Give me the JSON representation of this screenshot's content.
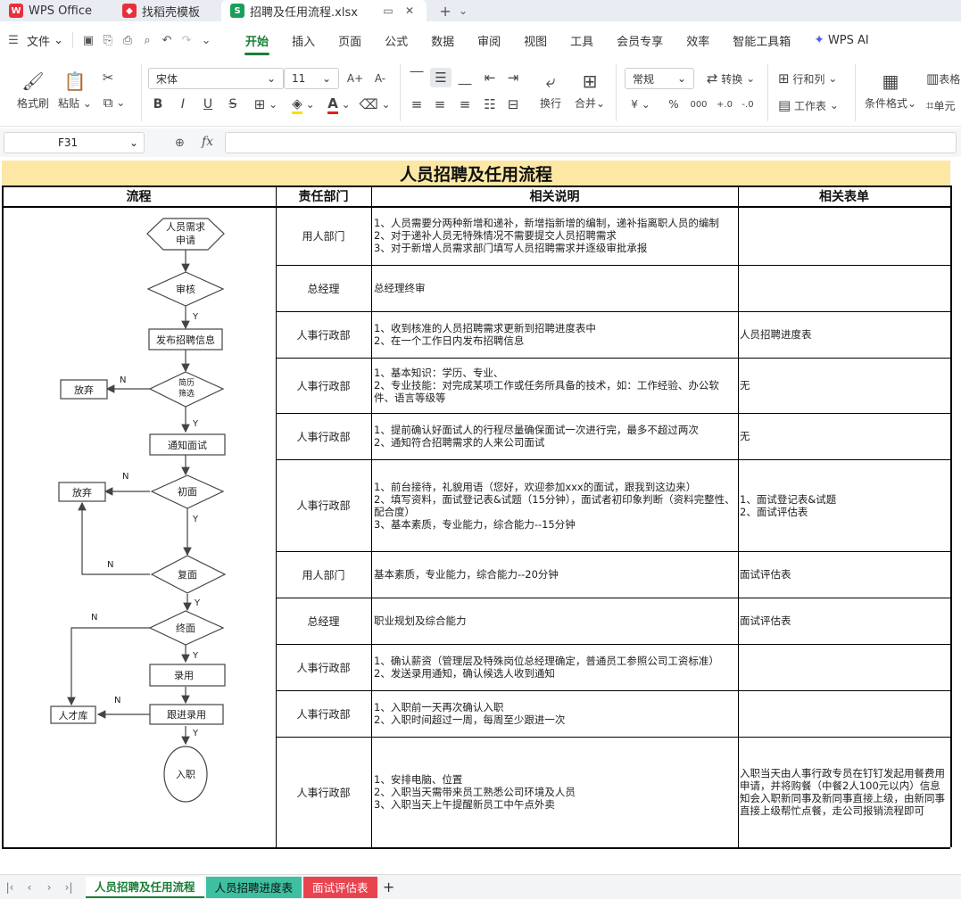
{
  "titlebar": {
    "tabs": [
      {
        "label": "WPS Office",
        "icon": "wps-logo-icon"
      },
      {
        "label": "找稻壳模板",
        "icon": "docer-icon"
      },
      {
        "label": "招聘及任用流程.xlsx",
        "icon": "spreadsheet-s-icon"
      }
    ],
    "logo_letter_w": "W",
    "logo_letter_s": "S"
  },
  "menubar": {
    "file_label": "文件",
    "items": [
      "开始",
      "插入",
      "页面",
      "公式",
      "数据",
      "审阅",
      "视图",
      "工具",
      "会员专享",
      "效率",
      "智能工具箱"
    ],
    "active": "开始",
    "wps_ai": "WPS AI"
  },
  "ribbon": {
    "format_painter": "格式刷",
    "paste": "粘贴",
    "font_name": "宋体",
    "font_size": "11",
    "wrap": "换行",
    "merge": "合并",
    "number_format": "常规",
    "convert": "转换",
    "row_col": "行和列",
    "worksheet": "工作表",
    "cond_format": "条件格式",
    "table_style": "表格",
    "cell": "单元",
    "bold": "B",
    "italic": "I",
    "underline": "U",
    "strike": "S",
    "currency": "¥",
    "percent": "%",
    "thousands": "000",
    "inc_dec": "+.0",
    "dec_dec": "-.0",
    "font_color_letter": "A",
    "grow_font": "A+",
    "shrink_font": "A-",
    "accent": "#1a7f37"
  },
  "formula_bar": {
    "cell_ref": "F31",
    "fx": "fx",
    "content": ""
  },
  "sheet": {
    "title": "人员招聘及任用流程",
    "headers": [
      "流程",
      "责任部门",
      "相关说明",
      "相关表单"
    ],
    "title_bg": "#fce8a4",
    "rows": [
      {
        "dept": "用人部门",
        "desc": [
          "1、人员需要分两种新增和递补，新增指新增的编制，递补指离职人员的编制",
          "2、对于递补人员无特殊情况不需要提交人员招聘需求",
          "3、对于新增人员需求部门填写人员招聘需求并逐级审批承报"
        ],
        "form": []
      },
      {
        "dept": "总经理",
        "desc": [
          "总经理终审"
        ],
        "form": []
      },
      {
        "dept": "人事行政部",
        "desc": [
          "1、收到核准的人员招聘需求更新到招聘进度表中",
          "2、在一个工作日内发布招聘信息"
        ],
        "form": [
          "人员招聘进度表"
        ]
      },
      {
        "dept": "人事行政部",
        "desc": [
          "1、基本知识：学历、专业、",
          "2、专业技能：对完成某项工作或任务所具备的技术，如：工作经验、办公软件、语言等级等"
        ],
        "form": [
          "无"
        ]
      },
      {
        "dept": "人事行政部",
        "desc": [
          "1、提前确认好面试人的行程尽量确保面试一次进行完，最多不超过两次",
          "2、通知符合招聘需求的人来公司面试"
        ],
        "form": [
          "无"
        ]
      },
      {
        "dept": "人事行政部",
        "desc": [
          "1、前台接待，礼貌用语（您好，欢迎参加xxx的面试，跟我到这边来）",
          "2、填写资料，面试登记表&试题（15分钟），面试者初印象判断（资料完整性、配合度）",
          "3、基本素质，专业能力，综合能力--15分钟"
        ],
        "form": [
          "1、面试登记表&试题",
          "2、面试评估表"
        ]
      },
      {
        "dept": "用人部门",
        "desc": [
          "基本素质，专业能力，综合能力--20分钟"
        ],
        "form": [
          "面试评估表"
        ]
      },
      {
        "dept": "总经理",
        "desc": [
          "职业规划及综合能力"
        ],
        "form": [
          "面试评估表"
        ]
      },
      {
        "dept": "人事行政部",
        "desc": [
          "1、确认薪资（管理层及特殊岗位总经理确定，普通员工参照公司工资标准）",
          "2、发送录用通知，确认候选人收到通知"
        ],
        "form": []
      },
      {
        "dept": "人事行政部",
        "desc": [
          "1、入职前一天再次确认入职",
          "2、入职时间超过一周，每周至少跟进一次"
        ],
        "form": []
      },
      {
        "dept": "人事行政部",
        "desc": [
          "1、安排电脑、位置",
          "2、入职当天需带来员工熟悉公司环境及人员",
          "3、入职当天上午提醒新员工中午点外卖"
        ],
        "form": [
          "入职当天由人事行政专员在钉钉发起用餐费用申请，并将购餐（中餐2人100元以内）信息知会入职新同事及新同事直接上级，由新同事直接上级帮忙点餐，走公司报销流程即可"
        ]
      }
    ]
  },
  "flowchart": {
    "start": [
      "人员需求",
      "申请"
    ],
    "review": "审核",
    "publish": "发布招聘信息",
    "screen": [
      "简历",
      "筛选"
    ],
    "abandon1": "放弃",
    "notify": "通知面试",
    "first": "初面",
    "abandon2": "放弃",
    "second": "复面",
    "final": "终面",
    "hire": "录用",
    "followup": "跟进录用",
    "talent": "人才库",
    "onboard": "入职",
    "yes": "Y",
    "no": "N"
  },
  "sheet_tabs": [
    {
      "label": "人员招聘及任用流程",
      "color": "#ffffff",
      "active": true
    },
    {
      "label": "人员招聘进度表",
      "color": "#3dbfa0"
    },
    {
      "label": "面试评估表",
      "color": "#e8434f"
    }
  ],
  "add_sheet": "+"
}
